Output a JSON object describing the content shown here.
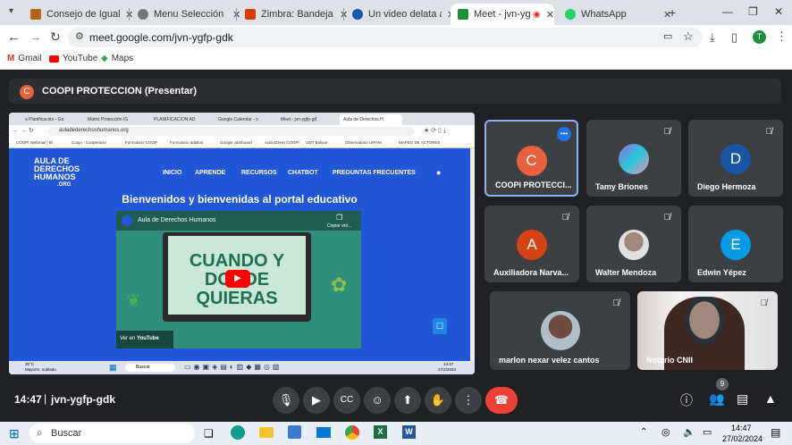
{
  "tabs": [
    {
      "title": "Consejo de Igualdad",
      "color": "#b5651d"
    },
    {
      "title": "Menu Selección",
      "color": "#777777"
    },
    {
      "title": "Zimbra: Bandeja de e",
      "color": "#d83b01"
    },
    {
      "title": "Un video delata al a",
      "color": "#1a56a6"
    },
    {
      "title": "Meet - jvn-ygfp-",
      "color": "#1e8e3e"
    },
    {
      "title": "WhatsApp",
      "color": "#25d366"
    }
  ],
  "url": "meet.google.com/jvn-ygfp-gdk",
  "bookmarks": [
    "Gmail",
    "YouTube",
    "Maps"
  ],
  "presenter_bar": {
    "initial": "C",
    "text": "COOPI PROTECCION (Presentar)"
  },
  "shared_screen": {
    "tabs": [
      "a Planificación - Go",
      "Matriz Protección IG",
      "PLANIFICACION AD",
      "Google Calendar - s",
      "Meet - jvn-ygfp-gd",
      "Aula de Derechos H"
    ],
    "url": "auladederechoshumanos.org",
    "bookmarks": [
      "COOPI Webmail | Bi",
      "Coopi - Cooperacio",
      "Formulario COOP",
      "Formulario adultos",
      "Google Jamboard",
      "Aula EDHH COOPI",
      "ODT Bolivar",
      "Observatorio UIFAM",
      "MAPEO DE ACTORES"
    ],
    "logo": [
      "AULA DE",
      "DERECHOS",
      "HUMANOS",
      ".ORG"
    ],
    "nav": [
      "INICIO",
      "APRENDE",
      "RECURSOS",
      "CHATBOT",
      "PREGUNTAS FRECUENTES"
    ],
    "welcome": "Bienvenidos y bienvenidas al portal educativo",
    "video": {
      "channel": "Aula de Derechos Humanos",
      "copy_label": "Copiar enl...",
      "lines": [
        "CUANDO Y",
        "DONDE",
        "QUIERAS"
      ],
      "watch_on": "Ver en",
      "youtube": "YouTube"
    },
    "weather": {
      "temp": "30°C",
      "condition": "Mayorm. nublado"
    },
    "search": "Buscar",
    "time": "14:47",
    "date": "27/2/2024"
  },
  "participants": [
    {
      "name": "COOPI PROTECCI...",
      "initial": "C",
      "color": "#e8603c",
      "speaking": true
    },
    {
      "name": "Tamy Briones",
      "initial": "",
      "color": "#7b5ba6",
      "photo": true
    },
    {
      "name": "Diego Hermoza",
      "initial": "D",
      "color": "#1a56a6"
    },
    {
      "name": "Auxiliadora Narva...",
      "initial": "A",
      "color": "#d84315"
    },
    {
      "name": "Walter Mendoza",
      "initial": "",
      "color": "#8d6e63",
      "photo": true
    },
    {
      "name": "Edwin Yépez",
      "initial": "E",
      "color": "#039be5"
    },
    {
      "name": "marlon nexar velez cantos",
      "initial": "",
      "color": "#6d4c41",
      "photo": true
    },
    {
      "name": "Notario CNII",
      "initial": "",
      "color": "#8d6e63",
      "video": true
    }
  ],
  "meeting": {
    "time": "14:47",
    "code": "jvn-ygfp-gdk",
    "people_count": "9"
  },
  "taskbar": {
    "search": "Buscar",
    "time": "14:47",
    "date": "27/02/2024"
  }
}
